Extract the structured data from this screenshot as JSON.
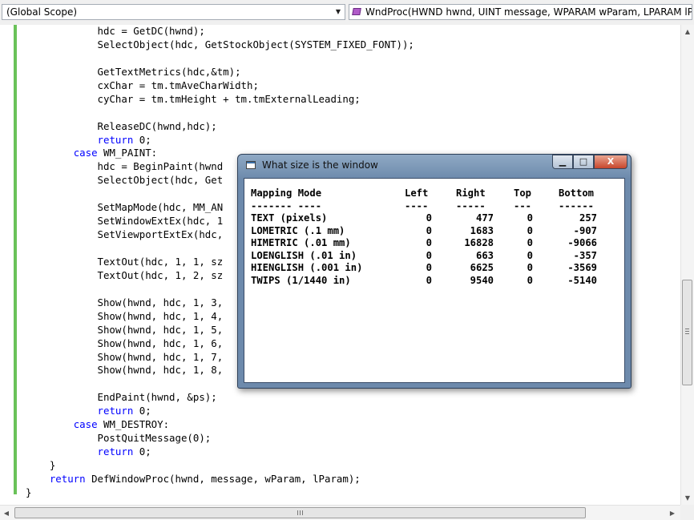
{
  "navbar": {
    "scope_combo": "(Global Scope)",
    "function_combo": "WndProc(HWND hwnd, UINT message, WPARAM wParam, LPARAM lPara"
  },
  "code_lines": [
    [
      {
        "t": "            hdc = GetDC(hwnd);"
      }
    ],
    [
      {
        "t": "            SelectObject(hdc, GetStockObject(SYSTEM_FIXED_FONT));"
      }
    ],
    [
      {
        "t": ""
      }
    ],
    [
      {
        "t": "            GetTextMetrics(hdc,&tm);"
      }
    ],
    [
      {
        "t": "            cxChar = tm.tmAveCharWidth;"
      }
    ],
    [
      {
        "t": "            cyChar = tm.tmHeight + tm.tmExternalLeading;"
      }
    ],
    [
      {
        "t": ""
      }
    ],
    [
      {
        "t": "            ReleaseDC(hwnd,hdc);"
      }
    ],
    [
      {
        "t": "            ",
        "k": false
      },
      {
        "t": "return",
        "k": true
      },
      {
        "t": " 0;"
      }
    ],
    [
      {
        "t": "        "
      },
      {
        "t": "case",
        "k": true
      },
      {
        "t": " WM_PAINT:"
      }
    ],
    [
      {
        "t": "            hdc = BeginPaint(hwnd"
      }
    ],
    [
      {
        "t": "            SelectObject(hdc, Get"
      }
    ],
    [
      {
        "t": ""
      }
    ],
    [
      {
        "t": "            SetMapMode(hdc, MM_AN"
      }
    ],
    [
      {
        "t": "            SetWindowExtEx(hdc, 1"
      }
    ],
    [
      {
        "t": "            SetViewportExtEx(hdc,"
      }
    ],
    [
      {
        "t": ""
      }
    ],
    [
      {
        "t": "            TextOut(hdc, 1, 1, sz"
      }
    ],
    [
      {
        "t": "            TextOut(hdc, 1, 2, sz"
      }
    ],
    [
      {
        "t": ""
      }
    ],
    [
      {
        "t": "            Show(hwnd, hdc, 1, 3,"
      }
    ],
    [
      {
        "t": "            Show(hwnd, hdc, 1, 4,"
      }
    ],
    [
      {
        "t": "            Show(hwnd, hdc, 1, 5,"
      }
    ],
    [
      {
        "t": "            Show(hwnd, hdc, 1, 6,"
      }
    ],
    [
      {
        "t": "            Show(hwnd, hdc, 1, 7,"
      }
    ],
    [
      {
        "t": "            Show(hwnd, hdc, 1, 8,"
      }
    ],
    [
      {
        "t": ""
      }
    ],
    [
      {
        "t": "            EndPaint(hwnd, &ps);"
      }
    ],
    [
      {
        "t": "            "
      },
      {
        "t": "return",
        "k": true
      },
      {
        "t": " 0;"
      }
    ],
    [
      {
        "t": "        "
      },
      {
        "t": "case",
        "k": true
      },
      {
        "t": " WM_DESTROY:"
      }
    ],
    [
      {
        "t": "            PostQuitMessage(0);"
      }
    ],
    [
      {
        "t": "            "
      },
      {
        "t": "return",
        "k": true
      },
      {
        "t": " 0;"
      }
    ],
    [
      {
        "t": "    }"
      }
    ],
    [
      {
        "t": "    "
      },
      {
        "t": "return",
        "k": true
      },
      {
        "t": " DefWindowProc(hwnd, message, wParam, lParam);"
      }
    ],
    [
      {
        "t": "}"
      }
    ]
  ],
  "dialog": {
    "title": "What size is the window",
    "buttons": {
      "minimize": "▁",
      "maximize": "□",
      "close": "X"
    },
    "header": [
      "Mapping Mode",
      "Left",
      "Right",
      "Top",
      "Bottom"
    ],
    "separator": [
      "------- ----",
      "----",
      "-----",
      "---",
      "------"
    ],
    "rows": [
      [
        "TEXT (pixels)",
        "0",
        "477",
        "0",
        "257"
      ],
      [
        "LOMETRIC (.1 mm)",
        "0",
        "1683",
        "0",
        "-907"
      ],
      [
        "HIMETRIC (.01 mm)",
        "0",
        "16828",
        "0",
        "-9066"
      ],
      [
        "LOENGLISH (.01 in)",
        "0",
        "663",
        "0",
        "-357"
      ],
      [
        "HIENGLISH (.001 in)",
        "0",
        "6625",
        "0",
        "-3569"
      ],
      [
        "TWIPS (1/1440 in)",
        "0",
        "9540",
        "0",
        "-5140"
      ]
    ]
  },
  "colors": {
    "keyword": "#0000ff",
    "change_bar": "#6ac259"
  }
}
